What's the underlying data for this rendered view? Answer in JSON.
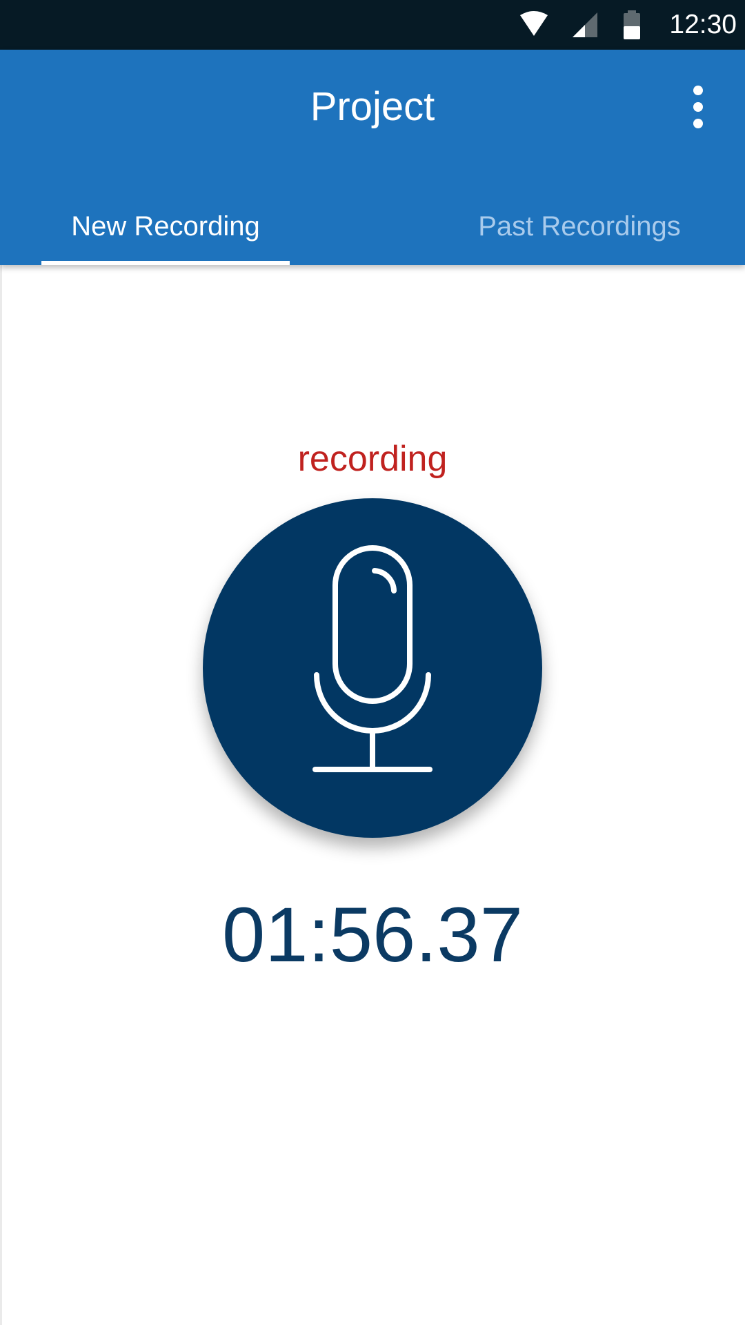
{
  "status_bar": {
    "time": "12:30",
    "icons": [
      "wifi-icon",
      "cellular-signal-icon",
      "battery-icon"
    ]
  },
  "app_bar": {
    "title": "Project",
    "menu_icon": "overflow-menu-icon"
  },
  "tabs": [
    {
      "label": "New Recording",
      "selected": true
    },
    {
      "label": "Past Recordings",
      "selected": false
    }
  ],
  "recorder": {
    "status": "recording",
    "button_icon": "microphone-icon",
    "elapsed": "01:56.37"
  },
  "colors": {
    "app_bar": "#1e73bd",
    "status_bar": "#061a25",
    "record_button": "#023763",
    "status_text": "#c0221f",
    "timer_text": "#0b3a63",
    "inactive_tab": "#a9cbec"
  }
}
